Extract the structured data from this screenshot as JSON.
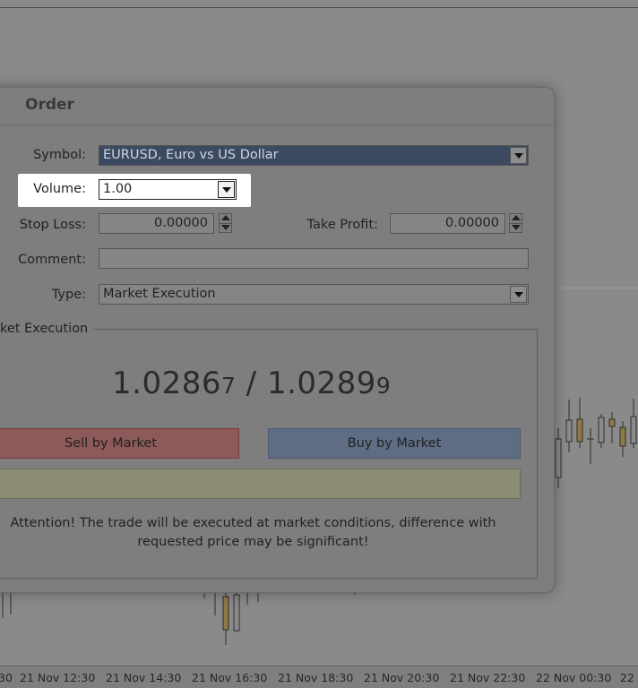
{
  "time_axis": {
    "labels": [
      "30",
      "21 Nov 12:30",
      "21 Nov 14:30",
      "21 Nov 16:30",
      "21 Nov 18:30",
      "21 Nov 20:30",
      "21 Nov 22:30",
      "22 Nov 00:30",
      "22"
    ]
  },
  "dialog": {
    "title": "Order",
    "symbol_label": "Symbol:",
    "symbol_value": "EURUSD, Euro vs US Dollar",
    "volume_label": "Volume:",
    "volume_value": "1.00",
    "stop_loss_label": "Stop Loss:",
    "stop_loss_value": "0.00000",
    "take_profit_label": "Take Profit:",
    "take_profit_value": "0.00000",
    "comment_label": "Comment:",
    "comment_value": "",
    "type_label": "Type:",
    "type_value": "Market Execution",
    "group_title": "ket Execution",
    "bid_main": "1.0286",
    "bid_small": "7",
    "separator": " / ",
    "ask_main": "1.0289",
    "ask_small": "9",
    "sell_label": "Sell by Market",
    "buy_label": "Buy by Market",
    "attention_line1": "Attention! The trade will be executed at market conditions, difference with",
    "attention_line2": "requested price may be significant!"
  },
  "colors": {
    "sell": "#8e5959",
    "buy": "#5f6d84",
    "symbol_highlight": "#3b4a60",
    "volume_highlight": "#ffffff"
  }
}
